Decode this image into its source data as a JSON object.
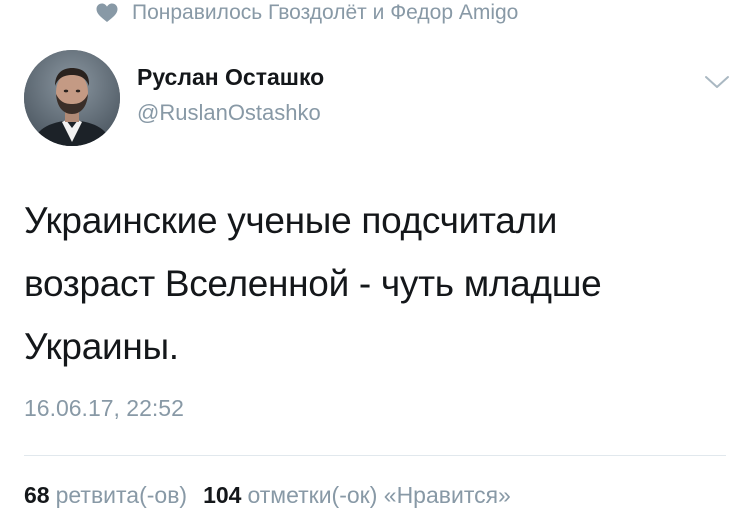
{
  "context": {
    "icon": "heart-icon",
    "text": "Понравилось Гвоздолёт и Федор Amigo"
  },
  "author": {
    "name": "Руслан Осташко",
    "handle": "@RuslanOstashko"
  },
  "tweet": {
    "lines": [
      "Украинские ученые подсчитали",
      "возраст Вселенной - чуть младше",
      "Украины."
    ],
    "timestamp": "16.06.17, 22:52"
  },
  "stats": {
    "retweets_count": "68",
    "retweets_label": "ретвита(-ов)",
    "likes_count": "104",
    "likes_label": "отметки(-ок) «Нравится»"
  },
  "colors": {
    "text": "#14171a",
    "muted": "#8899a6",
    "divider": "#e1e8ed"
  }
}
